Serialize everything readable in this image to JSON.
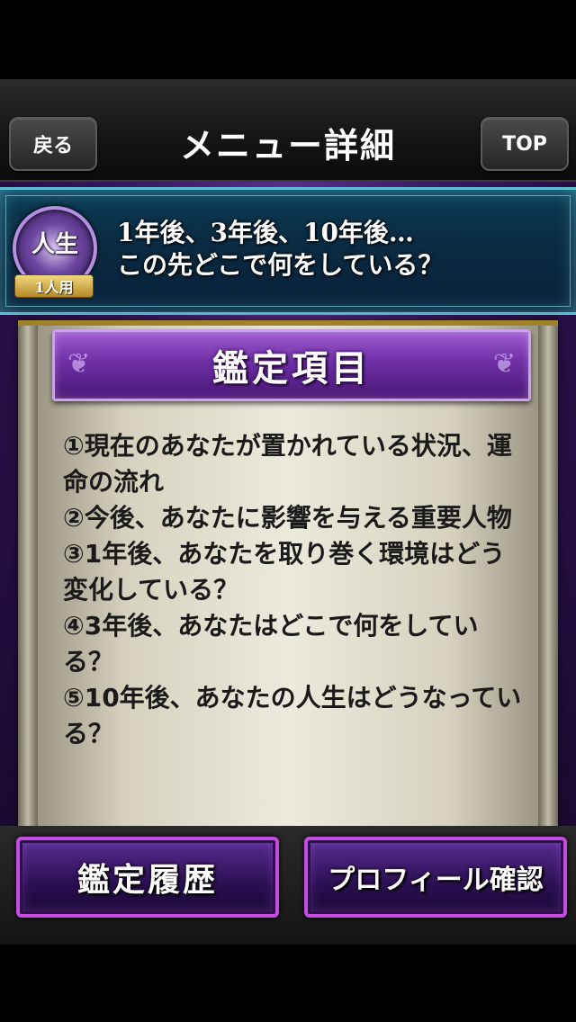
{
  "nav": {
    "back_label": "戻る",
    "title": "メニュー詳細",
    "top_label": "TOP"
  },
  "banner": {
    "badge_text": "人生",
    "badge_sub": "1人用",
    "line1": "1年後、3年後、10年後…",
    "line2": "この先どこで何をしている？"
  },
  "section": {
    "header": "鑑定項目",
    "items": [
      "①現在のあなたが置かれている状況、運命の流れ",
      "②今後、あなたに影響を与える重要人物",
      "③1年後、あなたを取り巻く環境はどう変化している？",
      "④3年後、あなたはどこで何をしている？",
      "⑤10年後、あなたの人生はどうなっている？"
    ]
  },
  "buttons": {
    "history": "鑑定履歴",
    "profile": "プロフィール確認"
  },
  "colors": {
    "accent_purple": "#6f2fa6",
    "banner_border": "#5bc0d6",
    "button_border": "#c44de0",
    "gold": "#a0822a"
  }
}
